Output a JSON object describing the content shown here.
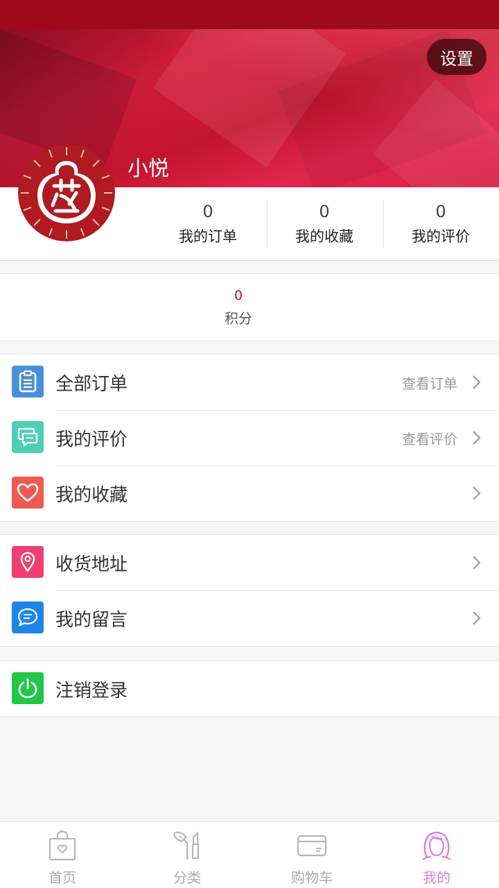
{
  "header": {
    "settings_label": "设置",
    "username": "小悦"
  },
  "stats": [
    {
      "value": "0",
      "label": "我的订单"
    },
    {
      "value": "0",
      "label": "我的收藏"
    },
    {
      "value": "0",
      "label": "我的评价"
    }
  ],
  "points": {
    "value": "0",
    "label": "积分"
  },
  "menu": {
    "group1": [
      {
        "title": "全部订单",
        "hint": "查看订单",
        "icon": "clipboard-icon",
        "color": "#4a90d9"
      },
      {
        "title": "我的评价",
        "hint": "查看评价",
        "icon": "comment-icon",
        "color": "#4ccfb5"
      },
      {
        "title": "我的收藏",
        "hint": "",
        "icon": "heart-icon",
        "color": "#ee5a52"
      }
    ],
    "group2": [
      {
        "title": "收货地址",
        "hint": "",
        "icon": "location-pin-icon",
        "color": "#ef3f72"
      },
      {
        "title": "我的留言",
        "hint": "",
        "icon": "message-icon",
        "color": "#1d86e8"
      }
    ],
    "group3": [
      {
        "title": "注销登录",
        "hint": "",
        "icon": "power-icon",
        "color": "#22c74a"
      }
    ]
  },
  "tabbar": [
    {
      "label": "首页",
      "icon": "shopping-bag-icon",
      "active": false
    },
    {
      "label": "分类",
      "icon": "makeup-brush-icon",
      "active": false
    },
    {
      "label": "购物车",
      "icon": "card-icon",
      "active": false
    },
    {
      "label": "我的",
      "icon": "user-face-icon",
      "active": true
    }
  ],
  "colors": {
    "brand": "#c4102b",
    "active_tab": "#e07be0"
  }
}
